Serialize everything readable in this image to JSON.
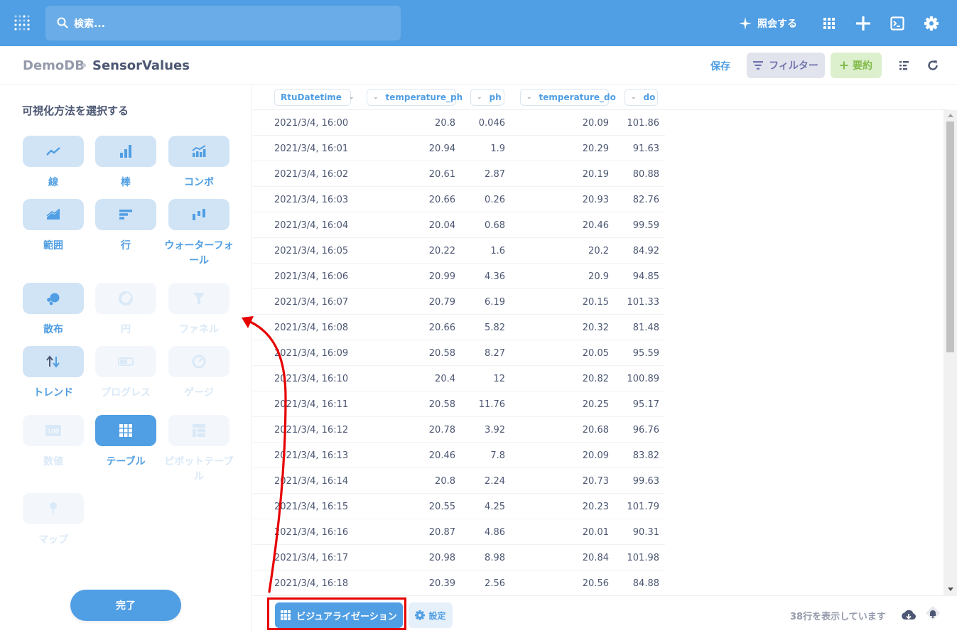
{
  "nav": {
    "search_placeholder": "検索...",
    "ask_label": "照会する"
  },
  "header": {
    "database": "DemoDB",
    "table": "SensorValues",
    "save_label": "保存",
    "filter_label": "フィルター",
    "summarize_label": "要約"
  },
  "sidebar": {
    "title": "可視化方法を選択する",
    "viz": [
      {
        "label": "線",
        "icon": "line-chart-icon",
        "state": "on"
      },
      {
        "label": "棒",
        "icon": "bar-chart-icon",
        "state": "on"
      },
      {
        "label": "コンボ",
        "icon": "combo-chart-icon",
        "state": "on"
      },
      {
        "label": "範囲",
        "icon": "area-chart-icon",
        "state": "on"
      },
      {
        "label": "行",
        "icon": "row-chart-icon",
        "state": "on"
      },
      {
        "label": "ウォーターフォール",
        "icon": "waterfall-chart-icon",
        "state": "on"
      },
      {
        "label": "散布",
        "icon": "scatter-chart-icon",
        "state": "on"
      },
      {
        "label": "円",
        "icon": "pie-chart-icon",
        "state": "off"
      },
      {
        "label": "ファネル",
        "icon": "funnel-icon",
        "state": "off"
      },
      {
        "label": "トレンド",
        "icon": "trend-icon",
        "state": "on"
      },
      {
        "label": "プログレス",
        "icon": "progress-icon",
        "state": "off"
      },
      {
        "label": "ゲージ",
        "icon": "gauge-icon",
        "state": "off"
      },
      {
        "label": "数値",
        "icon": "number-icon",
        "state": "off"
      },
      {
        "label": "テーブル",
        "icon": "table-icon",
        "state": "selected"
      },
      {
        "label": "ピボットテーブル",
        "icon": "pivot-table-icon",
        "state": "off"
      },
      {
        "label": "マップ",
        "icon": "map-pin-icon",
        "state": "off"
      }
    ],
    "done_label": "完了"
  },
  "table": {
    "columns": [
      "RtuDatetime",
      "temperature_ph",
      "ph",
      "temperature_do",
      "do"
    ],
    "rows": [
      [
        "2021/3/4, 16:00",
        "20.8",
        "0.046",
        "20.09",
        "101.86"
      ],
      [
        "2021/3/4, 16:01",
        "20.94",
        "1.9",
        "20.29",
        "91.63"
      ],
      [
        "2021/3/4, 16:02",
        "20.61",
        "2.87",
        "20.19",
        "80.88"
      ],
      [
        "2021/3/4, 16:03",
        "20.66",
        "0.26",
        "20.93",
        "82.76"
      ],
      [
        "2021/3/4, 16:04",
        "20.04",
        "0.68",
        "20.46",
        "99.59"
      ],
      [
        "2021/3/4, 16:05",
        "20.22",
        "1.6",
        "20.2",
        "84.92"
      ],
      [
        "2021/3/4, 16:06",
        "20.99",
        "4.36",
        "20.9",
        "94.85"
      ],
      [
        "2021/3/4, 16:07",
        "20.79",
        "6.19",
        "20.15",
        "101.33"
      ],
      [
        "2021/3/4, 16:08",
        "20.66",
        "5.82",
        "20.32",
        "81.48"
      ],
      [
        "2021/3/4, 16:09",
        "20.58",
        "8.27",
        "20.05",
        "95.59"
      ],
      [
        "2021/3/4, 16:10",
        "20.4",
        "12",
        "20.82",
        "100.89"
      ],
      [
        "2021/3/4, 16:11",
        "20.58",
        "11.76",
        "20.25",
        "95.17"
      ],
      [
        "2021/3/4, 16:12",
        "20.78",
        "3.92",
        "20.68",
        "96.76"
      ],
      [
        "2021/3/4, 16:13",
        "20.46",
        "7.8",
        "20.09",
        "83.82"
      ],
      [
        "2021/3/4, 16:14",
        "20.8",
        "2.24",
        "20.73",
        "99.63"
      ],
      [
        "2021/3/4, 16:15",
        "20.55",
        "4.25",
        "20.23",
        "101.79"
      ],
      [
        "2021/3/4, 16:16",
        "20.87",
        "4.86",
        "20.01",
        "90.31"
      ],
      [
        "2021/3/4, 16:17",
        "20.98",
        "8.98",
        "20.84",
        "101.98"
      ],
      [
        "2021/3/4, 16:18",
        "20.39",
        "2.56",
        "20.56",
        "84.88"
      ]
    ]
  },
  "footer": {
    "viz_button_label": "ビジュアライゼーション",
    "settings_label": "設定",
    "row_count": "38行を表示しています"
  },
  "colors": {
    "brand": "#509ee3",
    "annotation": "#e60000"
  }
}
